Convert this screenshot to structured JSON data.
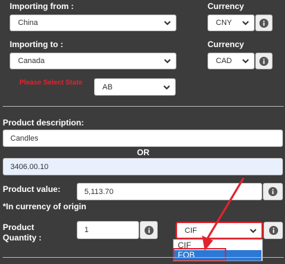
{
  "importing_from": {
    "label": "Importing from :",
    "value": "China"
  },
  "currency_from": {
    "label": "Currency",
    "value": "CNY"
  },
  "importing_to": {
    "label": "Importing to :",
    "value": "Canada"
  },
  "currency_to": {
    "label": "Currency",
    "value": "CAD"
  },
  "state": {
    "label": "Please Select State",
    "value": "AB"
  },
  "product_description": {
    "label": "Product description:",
    "value": "Candles"
  },
  "or_text": "OR",
  "hs_code": {
    "value": "3406.00.10"
  },
  "product_value": {
    "label": "Product value:",
    "value": "5,113.70",
    "note": "*In currency of origin"
  },
  "product_quantity": {
    "label_line1": "Product",
    "label_line2": "Quantity :",
    "value": "1"
  },
  "incoterm": {
    "value": "CIF",
    "options": [
      "CIF",
      "FOB"
    ],
    "highlighted": "FOB"
  },
  "colors": {
    "background": "#3c3c3c",
    "state_label": "#e0242d",
    "annotation": "#e0242d",
    "option_highlight": "#2b78d6",
    "hs_field_bg": "#e8f0fe"
  },
  "icons": {
    "info": "info-icon",
    "chevron": "chevron-down-icon"
  }
}
